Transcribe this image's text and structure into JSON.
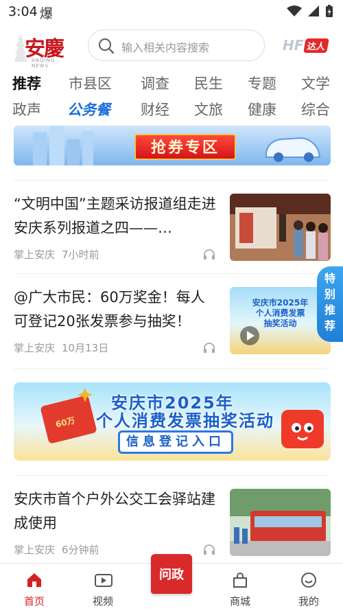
{
  "status": {
    "time": "3:04",
    "extra": "爆"
  },
  "header": {
    "logo_text": "安慶",
    "logo_sub": "ANQING NEWS",
    "search_placeholder": "输入相关内容搜索",
    "hf_text": "HF",
    "daren_label": "达人"
  },
  "tabs": {
    "row1": [
      "推荐",
      "市县区",
      "调查",
      "民生",
      "专题",
      "文学"
    ],
    "row2": [
      "政声",
      "公务餐",
      "财经",
      "文旅",
      "健康",
      "综合"
    ],
    "active": "推荐"
  },
  "banner1": {
    "cta": "抢券专区"
  },
  "articles": [
    {
      "title": "“文明中国”主题采访报道组走进安庆系列报道之四——…",
      "source": "掌上安庆",
      "time": "7小时前"
    },
    {
      "title": "@广大市民：60万奖金！每人可登记20张发票参与抽奖！",
      "source": "掌上安庆",
      "time": "10月13日",
      "thumb_line1": "安庆市2025年",
      "thumb_line2": "个人消费发票",
      "thumb_line3": "抽奖活动"
    },
    {
      "title": "安庆市首个户外公交工会驿站建成使用",
      "source": "掌上安庆",
      "time": "6分钟前"
    }
  ],
  "banner2": {
    "line1": "安庆市2025年",
    "line2": "个人消费发票抽奖活动",
    "button": "信息登记入口",
    "envelope_amount": "60万"
  },
  "side_tab": [
    "特",
    "别",
    "推",
    "荐"
  ],
  "bottom_nav": {
    "home": "首页",
    "video": "视频",
    "center": "问政",
    "mall": "商城",
    "mine": "我的"
  },
  "colors": {
    "accent_red": "#d42222",
    "special_tab_blue": "#1a6ed8"
  }
}
